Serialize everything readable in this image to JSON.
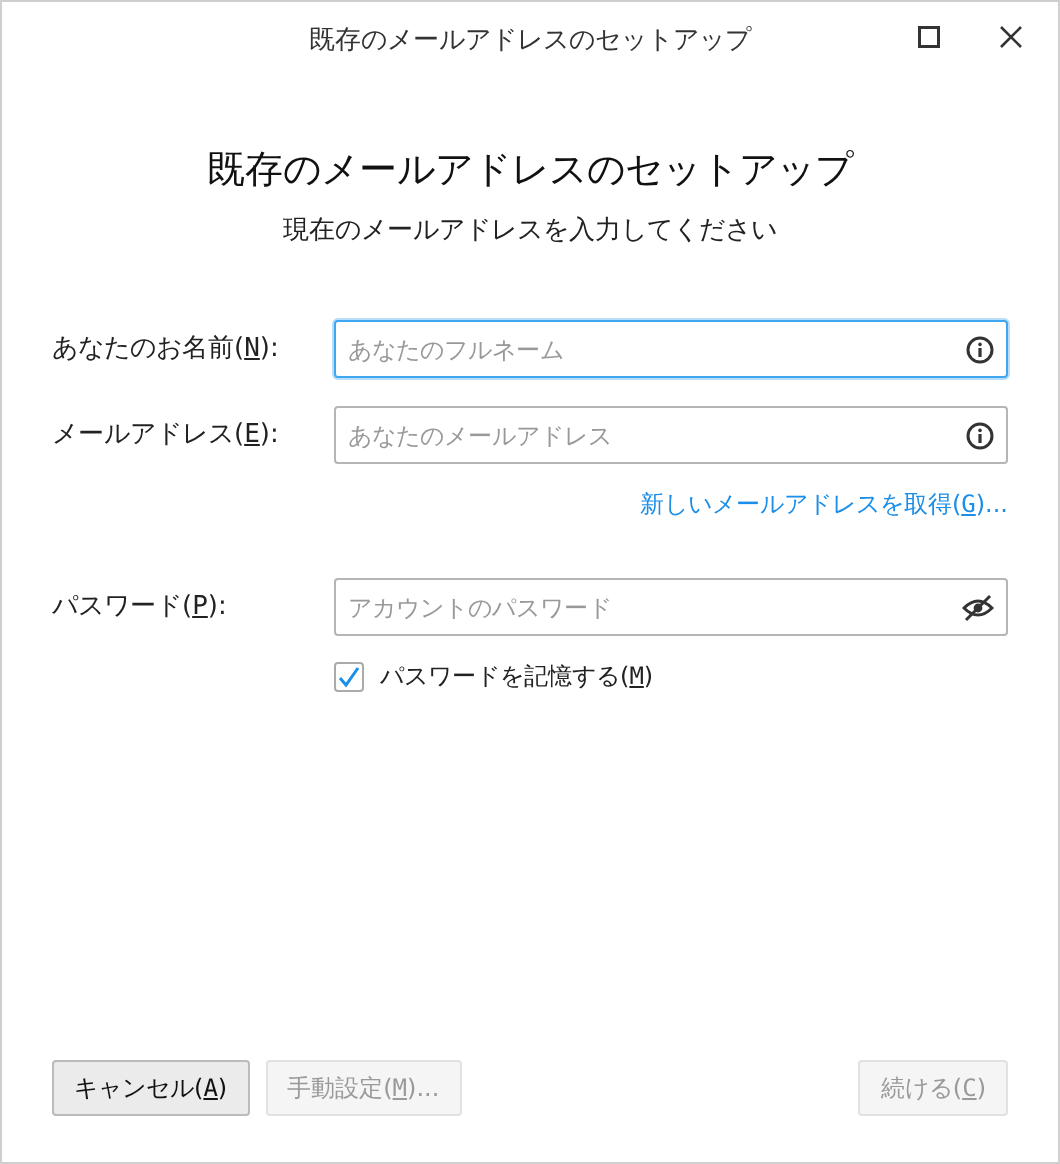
{
  "window": {
    "title": "既存のメールアドレスのセットアップ"
  },
  "heading": "既存のメールアドレスのセットアップ",
  "subtitle": "現在のメールアドレスを入力してください",
  "fields": [
    {
      "label": {
        "before": "あなたのお名前(",
        "key": "N",
        "after": "):"
      },
      "placeholder": "あなたのフルネーム",
      "focused": true,
      "kind": "info"
    },
    {
      "label": {
        "before": "メールアドレス(",
        "key": "E",
        "after": "):"
      },
      "placeholder": "あなたのメールアドレス",
      "focused": false,
      "kind": "info",
      "link": {
        "before": "新しいメールアドレスを取得(",
        "key": "G",
        "after": ")..."
      }
    },
    {
      "label": {
        "before": "パスワード(",
        "key": "P",
        "after": "):"
      },
      "placeholder": "アカウントのパスワード",
      "focused": false,
      "kind": "password"
    }
  ],
  "remember": {
    "label": {
      "before": "パスワードを記憶する(",
      "key": "M",
      "after": ")"
    },
    "checked": true
  },
  "buttons": [
    {
      "label": {
        "before": "キャンセル(",
        "key": "A",
        "after": ")"
      },
      "disabled": false
    },
    {
      "label": {
        "before": "手動設定(",
        "key": "M",
        "after": ")..."
      },
      "disabled": true
    },
    {
      "label": {
        "before": "続ける(",
        "key": "C",
        "after": ")"
      },
      "disabled": true
    }
  ]
}
